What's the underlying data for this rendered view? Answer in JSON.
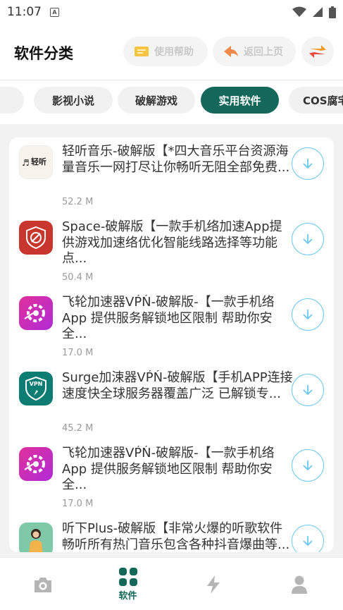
{
  "status_bar": {
    "time": "11:07",
    "notification_letter": "A"
  },
  "header": {
    "title": "软件分类",
    "help_label": "使用帮助",
    "back_label": "返回上页"
  },
  "tabs": [
    {
      "label": "影视小说",
      "active": false
    },
    {
      "label": "破解游戏",
      "active": false
    },
    {
      "label": "实用软件",
      "active": true
    },
    {
      "label": "COS腐宅",
      "active": false
    }
  ],
  "apps": [
    {
      "title": "轻听音乐-破解版【*四大音乐平台资源海量音乐一网打尽让你畅听无阻全部免费...",
      "size": "52.2 M",
      "icon": "qingting-logo-icon",
      "icon_text": "轻听"
    },
    {
      "title": "Space-破解版【一款手机络加速App提供游戏加速络优化智能线路选择等功能 点...",
      "size": "50.4 M",
      "icon": "space-logo-icon"
    },
    {
      "title": "飞轮加速器VṔŃ-破解版-【一款手机络App 提供服务解锁地区限制 帮助你安全...",
      "size": "17.0 M",
      "icon": "feilun-logo-icon"
    },
    {
      "title": "Surge加涑器VṔŃ-破解版【手机APP连接速度快全球服务器覆盖广泛 已解锁专...",
      "size": "45.2 M",
      "icon": "surge-vpn-logo-icon",
      "icon_text": "VPN"
    },
    {
      "title": "飞轮加速器VṔŃ-破解版-【一款手机络App 提供服务解锁地区限制 帮助你安全...",
      "size": "17.0 M",
      "icon": "feilun-logo-icon"
    },
    {
      "title": "听下Plus-破解版【非常火爆的听歌软件畅听所有热门音乐包含各种抖音爆曲等...",
      "size": "",
      "icon": "tingxia-logo-icon"
    }
  ],
  "bottom_nav": [
    {
      "label": "",
      "icon": "camera-icon",
      "active": false
    },
    {
      "label": "软件",
      "icon": "grid-icon",
      "active": true
    },
    {
      "label": "",
      "icon": "lightning-icon",
      "active": false
    },
    {
      "label": "",
      "icon": "person-icon",
      "active": false
    }
  ],
  "colors": {
    "accent": "#14685a",
    "download": "#6cc8f0",
    "background": "#f2f2f2"
  }
}
